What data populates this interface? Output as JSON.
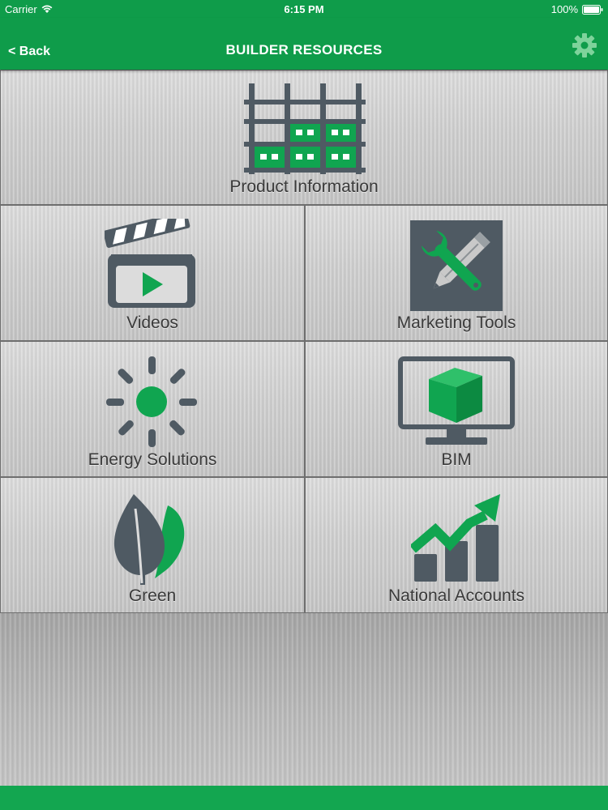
{
  "status_bar": {
    "carrier": "Carrier",
    "time": "6:15 PM",
    "battery": "100%"
  },
  "nav": {
    "back_label": "< Back",
    "title": "BUILDER RESOURCES"
  },
  "tiles": [
    {
      "label": "Product Information",
      "icon": "building-grid-icon"
    },
    {
      "label": "Videos",
      "icon": "clapperboard-icon"
    },
    {
      "label": "Marketing Tools",
      "icon": "wrench-pencil-icon"
    },
    {
      "label": "Energy Solutions",
      "icon": "sun-icon"
    },
    {
      "label": "BIM",
      "icon": "monitor-cube-icon"
    },
    {
      "label": "Green",
      "icon": "leaf-icon"
    },
    {
      "label": "National Accounts",
      "icon": "growth-chart-icon"
    }
  ],
  "colors": {
    "brand_green": "#0f9c4a",
    "icon_gray": "#4f5a63",
    "icon_green": "#10a550"
  }
}
